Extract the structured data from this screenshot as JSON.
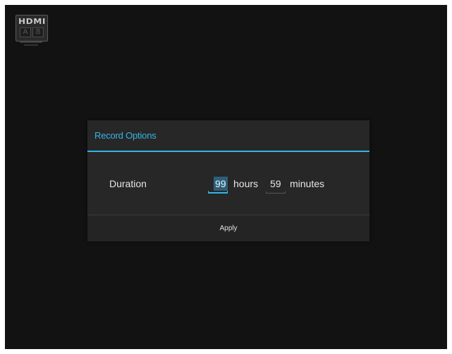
{
  "source_logo": {
    "text": "HDMI",
    "port_a": "A",
    "port_b": "B"
  },
  "dialog": {
    "title": "Record Options",
    "duration_label": "Duration",
    "hours_value": "99",
    "hours_unit": "hours",
    "minutes_value": "59",
    "minutes_unit": "minutes",
    "apply_label": "Apply"
  },
  "colors": {
    "accent": "#35b5e5",
    "background": "#121212",
    "dialog_background": "#272727",
    "selection": "#2d5f7a"
  }
}
